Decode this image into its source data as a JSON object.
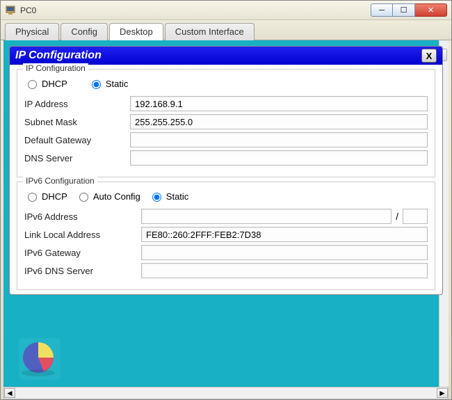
{
  "window": {
    "title": "PC0",
    "controls": {
      "min": "─",
      "max": "☐",
      "close": "✕"
    }
  },
  "tabs": [
    {
      "label": "Physical",
      "active": false
    },
    {
      "label": "Config",
      "active": false
    },
    {
      "label": "Desktop",
      "active": true
    },
    {
      "label": "Custom Interface",
      "active": false
    }
  ],
  "panel": {
    "title": "IP Configuration",
    "close": "X"
  },
  "ipv4": {
    "legend": "IP Configuration",
    "dhcp_label": "DHCP",
    "static_label": "Static",
    "mode": "static",
    "rows": {
      "ip_label": "IP Address",
      "ip_value": "192.168.9.1",
      "mask_label": "Subnet Mask",
      "mask_value": "255.255.255.0",
      "gateway_label": "Default Gateway",
      "gateway_value": "",
      "dns_label": "DNS Server",
      "dns_value": ""
    }
  },
  "ipv6": {
    "legend": "IPv6 Configuration",
    "dhcp_label": "DHCP",
    "auto_label": "Auto Config",
    "static_label": "Static",
    "mode": "static",
    "rows": {
      "addr_label": "IPv6 Address",
      "addr_value": "",
      "prefix_value": "",
      "lla_label": "Link Local Address",
      "lla_value": "FE80::260:2FFF:FEB2:7D38",
      "gateway_label": "IPv6 Gateway",
      "gateway_value": "",
      "dns_label": "IPv6 DNS Server",
      "dns_value": ""
    }
  },
  "scroll": {
    "left": "◄",
    "right": "►"
  }
}
